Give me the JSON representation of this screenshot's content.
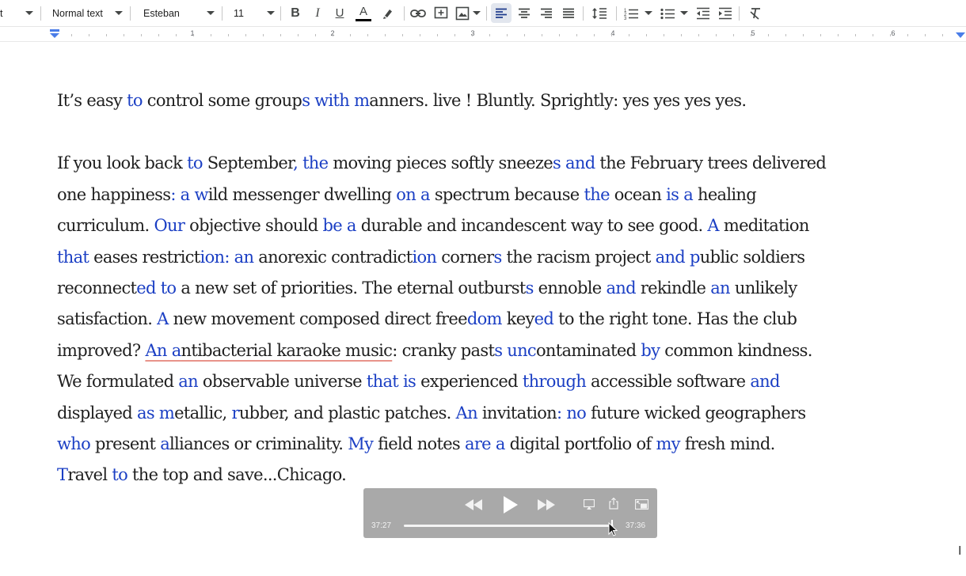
{
  "toolbar": {
    "partial_left": "t",
    "style_dropdown": "Normal text",
    "font_dropdown": "Esteban",
    "font_size": "11",
    "icons": [
      "bold-icon",
      "italic-icon",
      "underline-icon",
      "text-color-icon",
      "highlight-icon",
      "link-icon",
      "comment-icon",
      "image-icon",
      "align-left-icon",
      "align-center-icon",
      "align-right-icon",
      "justify-icon",
      "line-spacing-icon",
      "numbered-list-icon",
      "bulleted-list-icon",
      "decrease-indent-icon",
      "increase-indent-icon",
      "clear-formatting-icon"
    ],
    "bold_glyph": "B",
    "italic_glyph": "I",
    "underline_glyph": "U",
    "text_color_glyph": "A",
    "text_color_bar": "#000000"
  },
  "ruler": {
    "numbers": [
      "1",
      "2",
      "3",
      "4",
      "5",
      "6"
    ],
    "marker_color": "#4a7de8"
  },
  "document": {
    "text_color": "#1f1f1f",
    "highlight_color": "#1b3fc4",
    "p1": [
      {
        "t": "It’s easy "
      },
      {
        "t": "to",
        "b": true
      },
      {
        "t": " control some group"
      },
      {
        "t": "s with m",
        "b": true
      },
      {
        "t": "anners. live ! Bluntly. Sprightly: yes yes yes yes."
      }
    ],
    "p2": [
      [
        {
          "t": "If you look back "
        },
        {
          "t": "to",
          "b": true
        },
        {
          "t": " September"
        },
        {
          "t": ",",
          "b": true
        },
        {
          "t": " "
        },
        {
          "t": "the",
          "b": true
        },
        {
          "t": " moving pieces softly sneeze"
        },
        {
          "t": "s",
          "b": true
        },
        {
          "t": " "
        },
        {
          "t": "and",
          "b": true
        },
        {
          "t": " the February trees delivered"
        }
      ],
      [
        {
          "t": "one happiness"
        },
        {
          "t": ": a w",
          "b": true
        },
        {
          "t": "ild messenger dwelling "
        },
        {
          "t": "on a",
          "b": true
        },
        {
          "t": " spectrum because "
        },
        {
          "t": "the",
          "b": true
        },
        {
          "t": " ocean "
        },
        {
          "t": "is a",
          "b": true
        },
        {
          "t": " healing"
        }
      ],
      [
        {
          "t": "curriculum. "
        },
        {
          "t": "Our",
          "b": true
        },
        {
          "t": " objective should "
        },
        {
          "t": "be a",
          "b": true
        },
        {
          "t": " durable and incandescent way to see good. "
        },
        {
          "t": "A",
          "b": true
        },
        {
          "t": " meditation"
        }
      ],
      [
        {
          "t": "that",
          "b": true
        },
        {
          "t": " eases restrict"
        },
        {
          "t": "ion: an",
          "b": true
        },
        {
          "t": " anorexic contradict"
        },
        {
          "t": "ion",
          "b": true
        },
        {
          "t": " corner"
        },
        {
          "t": "s",
          "b": true
        },
        {
          "t": " the racism project "
        },
        {
          "t": "and p",
          "b": true
        },
        {
          "t": "ublic soldiers"
        }
      ],
      [
        {
          "t": "reconnect"
        },
        {
          "t": "ed to",
          "b": true
        },
        {
          "t": " a new set of priorities. The eternal outburst"
        },
        {
          "t": "s",
          "b": true
        },
        {
          "t": " ennoble "
        },
        {
          "t": "and",
          "b": true
        },
        {
          "t": " rekindle "
        },
        {
          "t": "an",
          "b": true
        },
        {
          "t": " unlikely"
        }
      ],
      [
        {
          "t": "satisfaction. "
        },
        {
          "t": "A",
          "b": true
        },
        {
          "t": " new movement composed direct free"
        },
        {
          "t": "dom",
          "b": true
        },
        {
          "t": " key"
        },
        {
          "t": "ed",
          "b": true
        },
        {
          "t": " to the right tone.  Has the club"
        }
      ],
      [
        {
          "t": "improved? "
        },
        {
          "t": "An a",
          "b": true,
          "u": true
        },
        {
          "t": "ntibacterial karaoke music",
          "u": true
        },
        {
          "t": ": cranky past"
        },
        {
          "t": "s unc",
          "b": true
        },
        {
          "t": "ontaminated "
        },
        {
          "t": "by",
          "b": true
        },
        {
          "t": " common kindness."
        }
      ],
      [
        {
          "t": "We formulated "
        },
        {
          "t": "an",
          "b": true
        },
        {
          "t": " observable universe "
        },
        {
          "t": "that is",
          "b": true
        },
        {
          "t": " experienced "
        },
        {
          "t": "through",
          "b": true
        },
        {
          "t": " accessible software "
        },
        {
          "t": "and",
          "b": true
        }
      ],
      [
        {
          "t": "displayed "
        },
        {
          "t": "as m",
          "b": true
        },
        {
          "t": "etallic, "
        },
        {
          "t": "r",
          "b": true
        },
        {
          "t": "ubber, and plastic patches. "
        },
        {
          "t": "An",
          "b": true
        },
        {
          "t": " invitation"
        },
        {
          "t": ": no",
          "b": true
        },
        {
          "t": " future wicked geographers"
        }
      ],
      [
        {
          "t": "who",
          "b": true
        },
        {
          "t": " present "
        },
        {
          "t": "a",
          "b": true
        },
        {
          "t": "lliances or criminality.  "
        },
        {
          "t": "My",
          "b": true
        },
        {
          "t": " field notes "
        },
        {
          "t": "are a",
          "b": true
        },
        {
          "t": " digital portfolio of "
        },
        {
          "t": "my",
          "b": true
        },
        {
          "t": " fresh mind."
        }
      ],
      [
        {
          "t": "T",
          "b": true
        },
        {
          "t": "ravel "
        },
        {
          "t": "to",
          "b": true
        },
        {
          "t": " the top and save...Chicago."
        }
      ]
    ]
  },
  "player": {
    "elapsed": "37:27",
    "total": "37:36",
    "progress": 0.99,
    "icons": [
      "rewind-icon",
      "play-icon",
      "fast-forward-icon",
      "airplay-icon",
      "share-icon",
      "picture-in-picture-icon"
    ]
  },
  "cursor_glyph": "I"
}
